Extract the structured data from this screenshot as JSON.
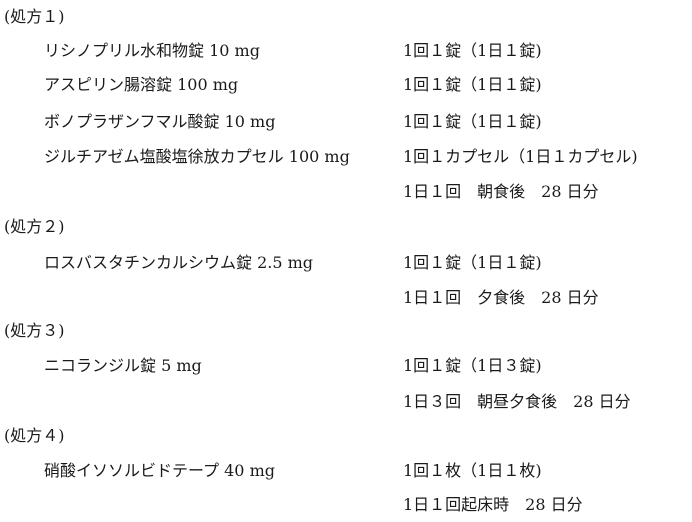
{
  "prescriptions": [
    {
      "heading": "(処方１)",
      "rows": [
        {
          "drug": "リシノプリル水和物錠 10 mg",
          "dose": "1回１錠（1日１錠)"
        },
        {
          "drug": "アスピリン腸溶錠 100 mg",
          "dose": "1回１錠（1日１錠)"
        },
        {
          "drug": "ボノプラザンフマル酸錠 10 mg",
          "dose": "1回１錠（1日１錠)"
        },
        {
          "drug": "ジルチアゼム塩酸塩徐放カプセル 100 mg",
          "dose": "1回１カプセル（1日１カプセル)"
        },
        {
          "drug": "",
          "dose": "1日１回　朝食後　28 日分"
        }
      ]
    },
    {
      "heading": "(処方２)",
      "rows": [
        {
          "drug": "ロスバスタチンカルシウム錠 2.5 mg",
          "dose": "1回１錠（1日１錠)"
        },
        {
          "drug": "",
          "dose": "1日１回　夕食後　28 日分"
        }
      ]
    },
    {
      "heading": "(処方３)",
      "rows": [
        {
          "drug": "ニコランジル錠 5 mg",
          "dose": "1回１錠（1日３錠)"
        },
        {
          "drug": "",
          "dose": "1日３回　朝昼夕食後　28 日分"
        }
      ]
    },
    {
      "heading": "(処方４)",
      "rows": [
        {
          "drug": "硝酸イソソルビドテープ 40 mg",
          "dose": "1回１枚（1日１枚)"
        },
        {
          "drug": "",
          "dose": "1日１回起床時　28 日分"
        }
      ]
    }
  ]
}
